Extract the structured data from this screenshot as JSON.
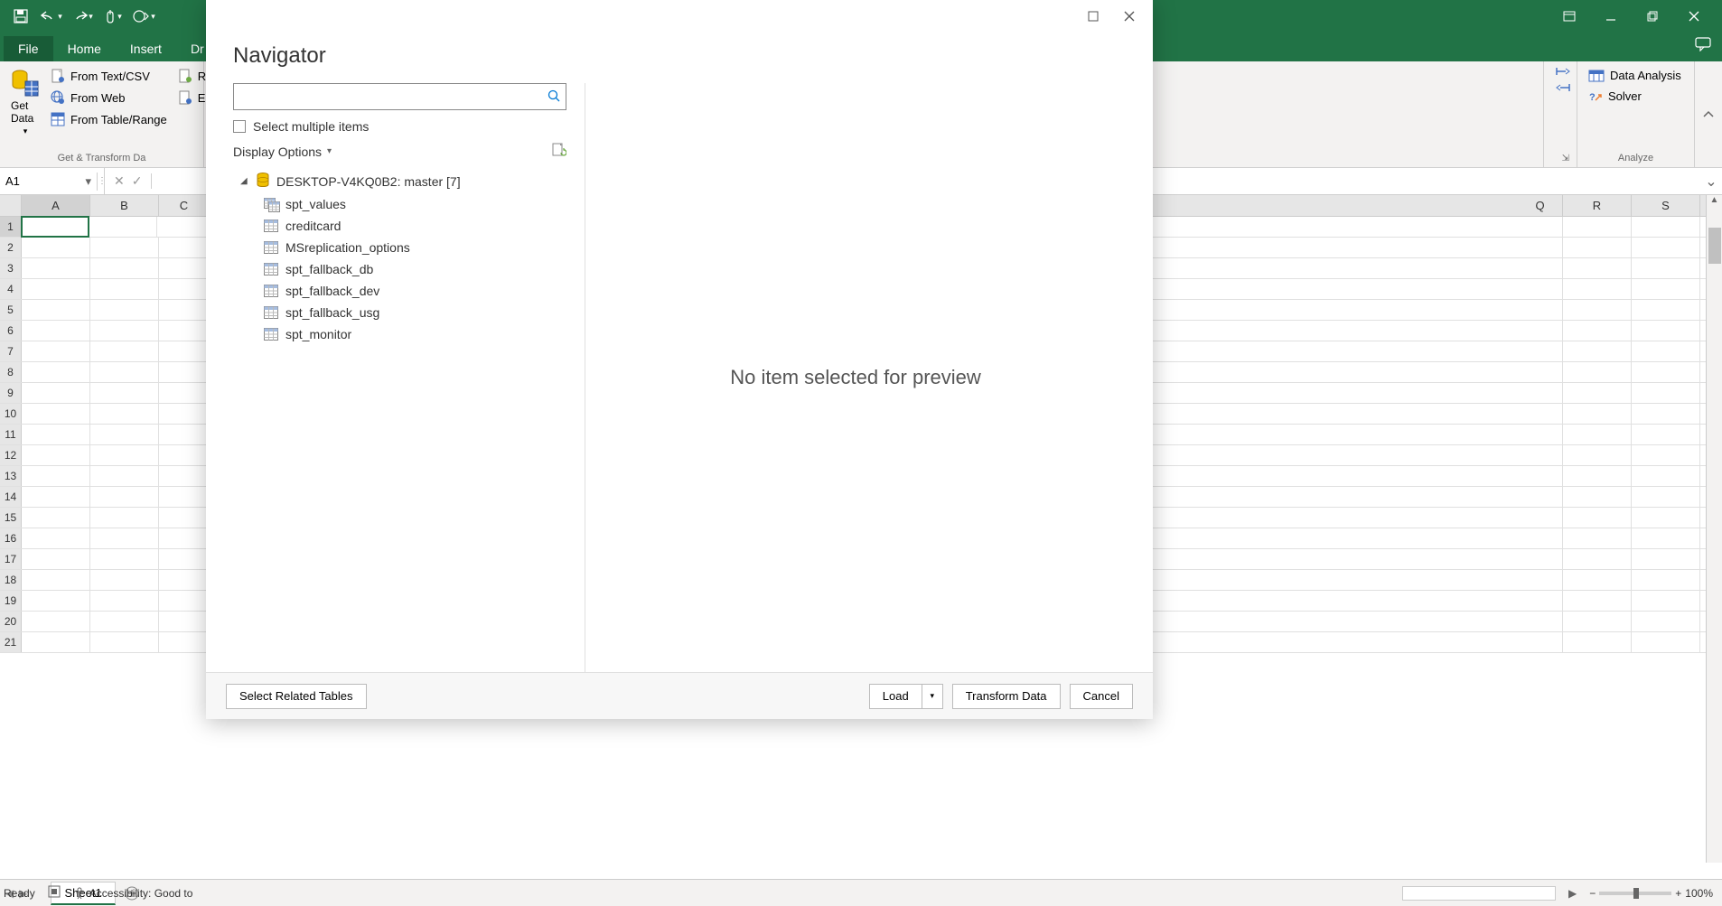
{
  "titlebar": {
    "save_icon": "save-icon",
    "undo_icon": "undo-icon",
    "redo_icon": "redo-icon"
  },
  "ribbon_tabs": {
    "file": "File",
    "home": "Home",
    "insert": "Insert",
    "draw": "Dr"
  },
  "ribbon": {
    "get_data": "Get Data",
    "from_text_csv": "From Text/CSV",
    "from_web": "From Web",
    "from_table_range": "From Table/Range",
    "r_partial": "R",
    "e_partial": "E",
    "group_get_transform": "Get & Transform Da",
    "data_analysis": "Data Analysis",
    "solver": "Solver",
    "group_analyze": "Analyze"
  },
  "formula_bar": {
    "name_box": "A1"
  },
  "columns_left": [
    "A",
    "B",
    "C"
  ],
  "columns_right": [
    "Q",
    "R",
    "S"
  ],
  "rows": [
    "1",
    "2",
    "3",
    "4",
    "5",
    "6",
    "7",
    "8",
    "9",
    "10",
    "11",
    "12",
    "13",
    "14",
    "15",
    "16",
    "17",
    "18",
    "19",
    "20",
    "21"
  ],
  "sheet_tabs": {
    "sheet1": "Sheet1"
  },
  "status": {
    "ready": "Ready",
    "accessibility": "Accessibility: Good to",
    "zoom": "100%"
  },
  "dialog": {
    "title": "Navigator",
    "select_multiple": "Select multiple items",
    "display_options": "Display Options",
    "root_label": "DESKTOP-V4KQ0B2: master [7]",
    "items": [
      {
        "label": "spt_values",
        "kind": "view"
      },
      {
        "label": "creditcard",
        "kind": "table"
      },
      {
        "label": "MSreplication_options",
        "kind": "table"
      },
      {
        "label": "spt_fallback_db",
        "kind": "table"
      },
      {
        "label": "spt_fallback_dev",
        "kind": "table"
      },
      {
        "label": "spt_fallback_usg",
        "kind": "table"
      },
      {
        "label": "spt_monitor",
        "kind": "table"
      }
    ],
    "preview_empty": "No item selected for preview",
    "select_related": "Select Related Tables",
    "load": "Load",
    "transform": "Transform Data",
    "cancel": "Cancel"
  }
}
